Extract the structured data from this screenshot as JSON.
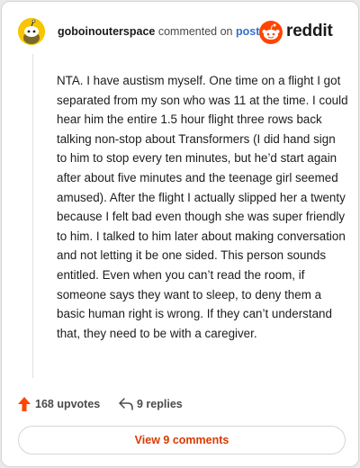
{
  "header": {
    "username": "goboinouterspace",
    "action_text": "commented on",
    "post_link": "post",
    "brand": "reddit"
  },
  "comment": {
    "body": "NTA. I have austism myself. One time on a flight I got separated from my son who was 11 at the time. I could hear him the entire 1.5 hour flight three rows back talking non-stop about Transformers (I did hand sign to him to stop every ten minutes, but he’d start again after about five minutes and the teenage girl seemed amused). After the flight I actually slipped her a twenty because I felt bad even though she was super friendly to him. I talked to him later about making conversation and not letting it be one sided. This person sounds entitled. Even when you can’t read the room, if someone says they want to sleep, to deny them a basic human right is wrong. If they can’t understand that, they need to be with a caregiver."
  },
  "actions": {
    "upvotes": "168 upvotes",
    "replies": "9 replies"
  },
  "view_comments_label": "View 9 comments",
  "colors": {
    "accent": "#ff4500",
    "link": "#3a6fc7",
    "button_text": "#d93a00",
    "avatar_bg": "#f7c600"
  }
}
